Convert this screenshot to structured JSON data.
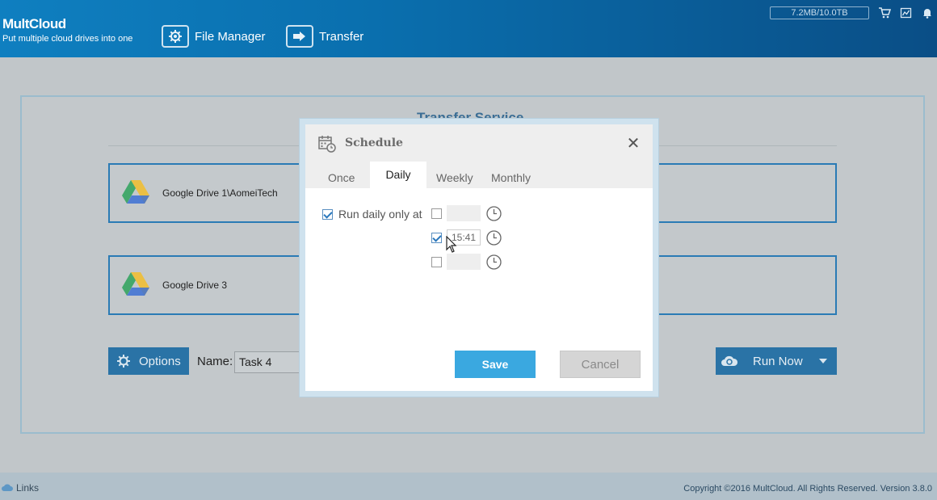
{
  "header": {
    "logo": "MultCloud",
    "tagline": "Put multiple cloud drives into one",
    "nav": [
      {
        "label": "File Manager",
        "icon": "gear-icon"
      },
      {
        "label": "Transfer",
        "icon": "transfer-arrow-icon"
      }
    ],
    "storage_usage": "7.2MB/10.0TB",
    "icons": [
      "cart-icon",
      "chart-icon",
      "bell-icon"
    ]
  },
  "main": {
    "title": "Transfer Service",
    "source": {
      "name": "Google Drive 1\\AomeiTech",
      "icon": "google-drive-icon"
    },
    "destination": {
      "name": "Google Drive 3",
      "icon": "google-drive-icon"
    },
    "options_label": "Options",
    "name_label": "Name:",
    "task_name": "Task 4",
    "run_now_label": "Run Now"
  },
  "modal": {
    "title": "Schedule",
    "tabs": [
      {
        "label": "Once",
        "active": false
      },
      {
        "label": "Daily",
        "active": true
      },
      {
        "label": "Weekly",
        "active": false
      },
      {
        "label": "Monthly",
        "active": false
      }
    ],
    "run_daily_label": "Run daily only at",
    "run_daily_checked": true,
    "times": [
      {
        "checked": false,
        "value": ""
      },
      {
        "checked": true,
        "value": "15:41"
      },
      {
        "checked": false,
        "value": ""
      }
    ],
    "save_label": "Save",
    "cancel_label": "Cancel"
  },
  "footer": {
    "links_label": "Links",
    "copyright": "Copyright ©2016 MultCloud. All Rights Reserved. Version 3.8.0"
  },
  "colors": {
    "header_blue": "#0f7fc0",
    "accent": "#3aa8e0",
    "button_dark": "#2a73a6"
  }
}
